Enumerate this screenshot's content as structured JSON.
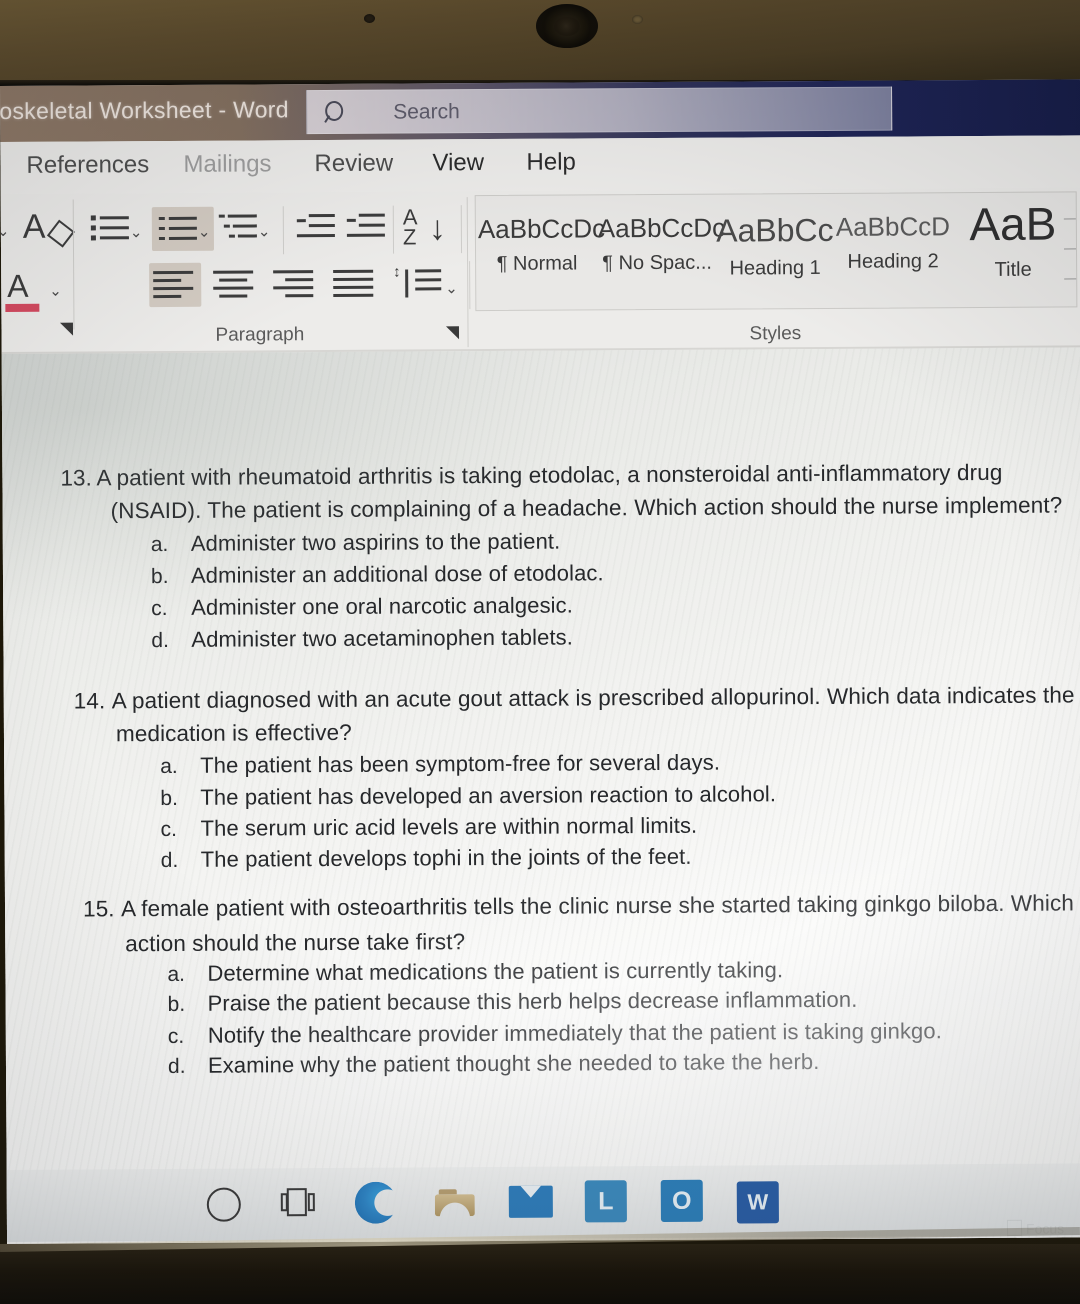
{
  "window": {
    "title": "closkeletal Worksheet  -  Word",
    "search_placeholder": "Search",
    "search_icon": "search-icon"
  },
  "ribbon": {
    "tabs": [
      {
        "label": "References",
        "state": "normal"
      },
      {
        "label": "Mailings",
        "state": "dim"
      },
      {
        "label": "Review",
        "state": "normal"
      },
      {
        "label": "View",
        "state": "active"
      },
      {
        "label": "Help",
        "state": "normal"
      }
    ],
    "groups": [
      {
        "label": "Paragraph"
      },
      {
        "label": "Styles"
      }
    ],
    "font_group": {
      "clear_formatting": "clear-formatting-icon",
      "font_color": "font-color-icon"
    },
    "paragraph_buttons": [
      "bullets",
      "numbering",
      "multilevel-list",
      "decrease-indent",
      "increase-indent",
      "sort",
      "show-formatting-marks",
      "align-left",
      "center",
      "align-right",
      "justify",
      "line-spacing",
      "shading",
      "borders"
    ]
  },
  "styles": [
    {
      "preview": "AaBbCcDc",
      "name": "¶ Normal"
    },
    {
      "preview": "AaBbCcDc",
      "name": "¶ No Spac..."
    },
    {
      "preview": "AaBbCc",
      "name": "Heading 1"
    },
    {
      "preview": "AaBbCcD",
      "name": "Heading 2"
    },
    {
      "preview": "AaB",
      "name": "Title"
    }
  ],
  "document": {
    "questions": [
      {
        "number": "13.",
        "lines": [
          "A patient with rheumatoid arthritis is taking etodolac, a nonsteroidal anti-inflammatory drug",
          "(NSAID). The patient is complaining of a headache. Which action should the nurse implement?"
        ],
        "options": [
          {
            "letter": "a.",
            "text": "Administer two aspirins to the patient."
          },
          {
            "letter": "b.",
            "text": "Administer an additional dose of etodolac."
          },
          {
            "letter": "c.",
            "text": "Administer one oral narcotic analgesic."
          },
          {
            "letter": "d.",
            "text": "Administer two acetaminophen tablets."
          }
        ]
      },
      {
        "number": "14.",
        "lines": [
          "A patient diagnosed with an acute gout attack is prescribed allopurinol. Which data indicates the",
          "medication is effective?"
        ],
        "options": [
          {
            "letter": "a.",
            "text": "The patient has been symptom-free for several days."
          },
          {
            "letter": "b.",
            "text": "The patient has developed an aversion reaction to alcohol."
          },
          {
            "letter": "c.",
            "text": "The serum uric acid levels are within normal limits."
          },
          {
            "letter": "d.",
            "text": "The patient develops tophi in the joints of the feet."
          }
        ]
      },
      {
        "number": "15.",
        "lines": [
          "A female patient with osteoarthritis tells the clinic nurse she started taking ginkgo biloba. Which",
          "action should the nurse take first?"
        ],
        "options": [
          {
            "letter": "a.",
            "text": "Determine what medications the patient is currently taking."
          },
          {
            "letter": "b.",
            "text": "Praise the patient because this herb helps decrease inflammation."
          },
          {
            "letter": "c.",
            "text": "Notify the healthcare provider immediately that the patient is taking ginkgo."
          },
          {
            "letter": "d.",
            "text": "Examine why the patient thought she needed to take the herb."
          }
        ]
      }
    ],
    "focus_indicator": "Focus"
  },
  "taskbar": {
    "items": [
      {
        "name": "cortana-icon",
        "label": ""
      },
      {
        "name": "task-view-icon",
        "label": ""
      },
      {
        "name": "edge-icon",
        "label": ""
      },
      {
        "name": "file-explorer-icon",
        "label": ""
      },
      {
        "name": "mail-icon",
        "label": ""
      },
      {
        "name": "linkedin-app-icon",
        "label": "L"
      },
      {
        "name": "office-app-icon",
        "label": "O"
      },
      {
        "name": "word-app-icon",
        "label": "W"
      }
    ]
  },
  "colors": {
    "titlebar_left": "#8e7866",
    "titlebar_right": "#141a46",
    "ribbon_bg": "#edecea",
    "page_bg": "#f4f4f2",
    "text": "#26282b",
    "accent_word": "#2a5fa8"
  }
}
